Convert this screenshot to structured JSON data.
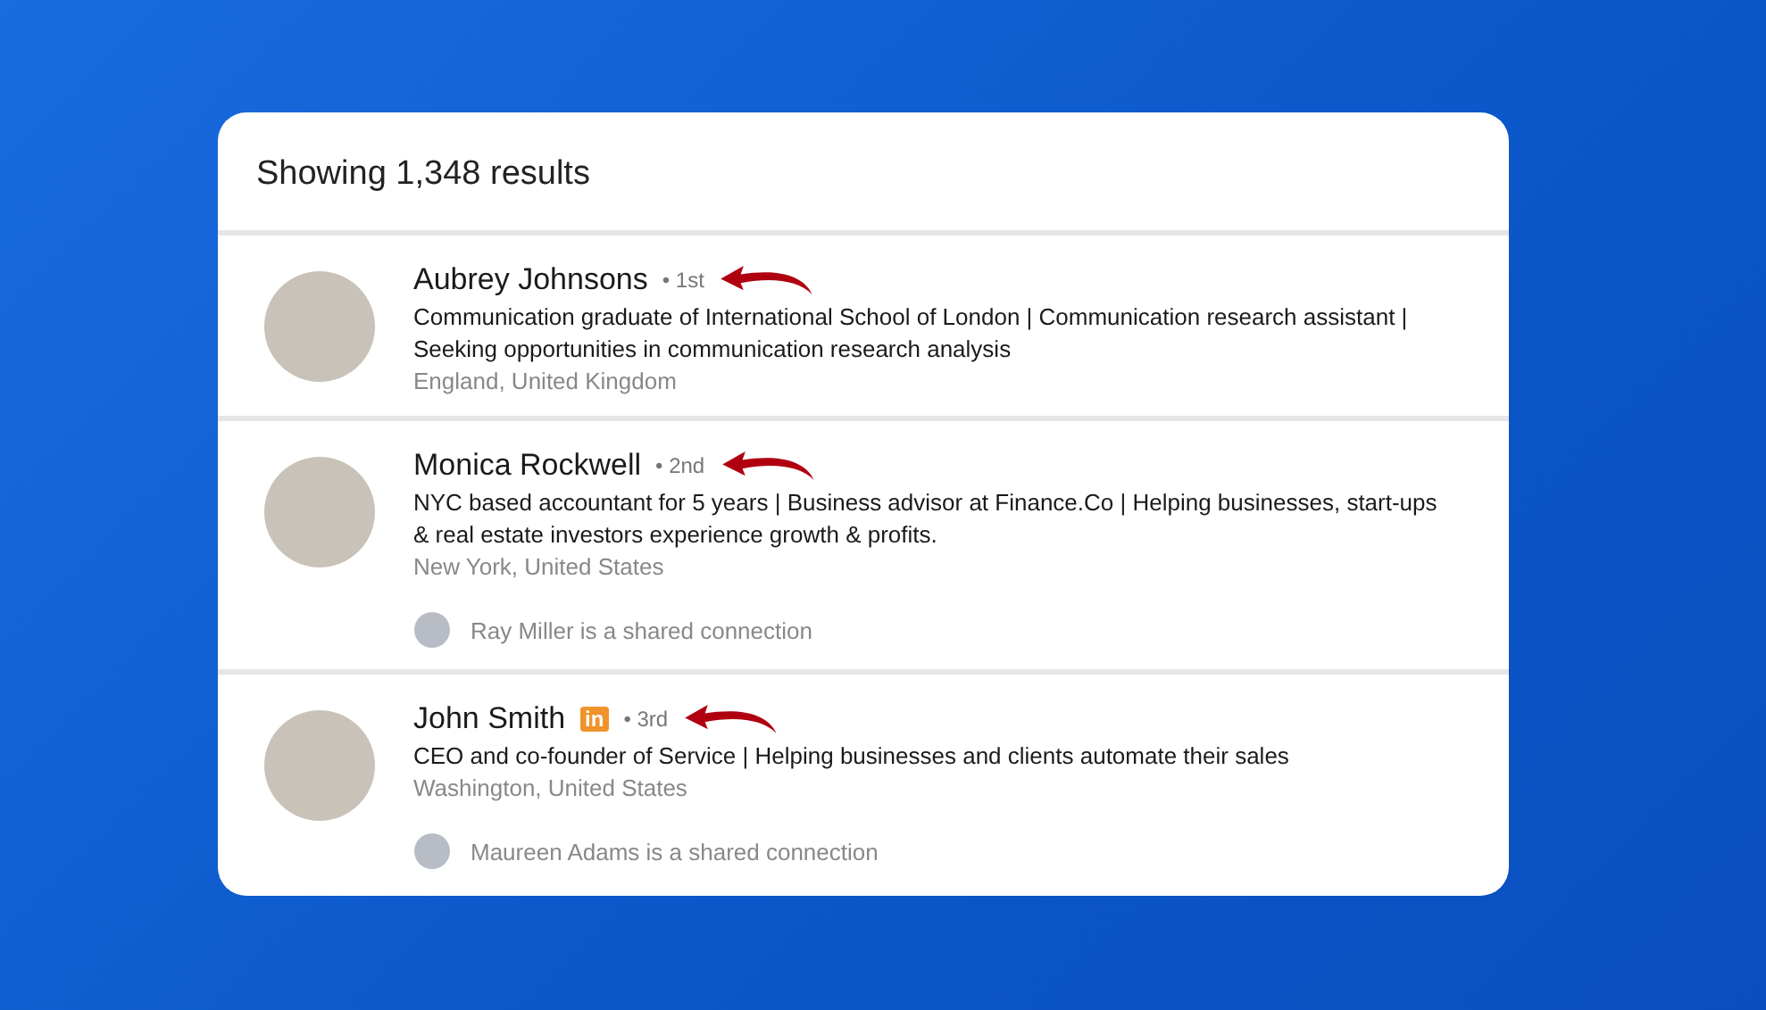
{
  "results_header": "Showing 1,348 results",
  "results": [
    {
      "name": "Aubrey Johnsons",
      "degree": "• 1st",
      "headline": "Communication graduate of International School of London | Communication research assistant | Seeking opportunities in communication research analysis",
      "location": "England, United Kingdom"
    },
    {
      "name": "Monica Rockwell",
      "degree": "• 2nd",
      "headline": "NYC based accountant for 5 years | Business advisor at Finance.Co | Helping businesses, start-ups & real estate investors experience growth & profits.",
      "location": "New York, United States",
      "shared_connection": "Ray Miller is a shared connection"
    },
    {
      "name": "John Smith",
      "badge": "in",
      "degree": "• 3rd",
      "headline": "CEO and co-founder of Service | Helping businesses and clients automate their sales",
      "location": "Washington, United States",
      "shared_connection": "Maureen Adams is a shared connection"
    }
  ]
}
